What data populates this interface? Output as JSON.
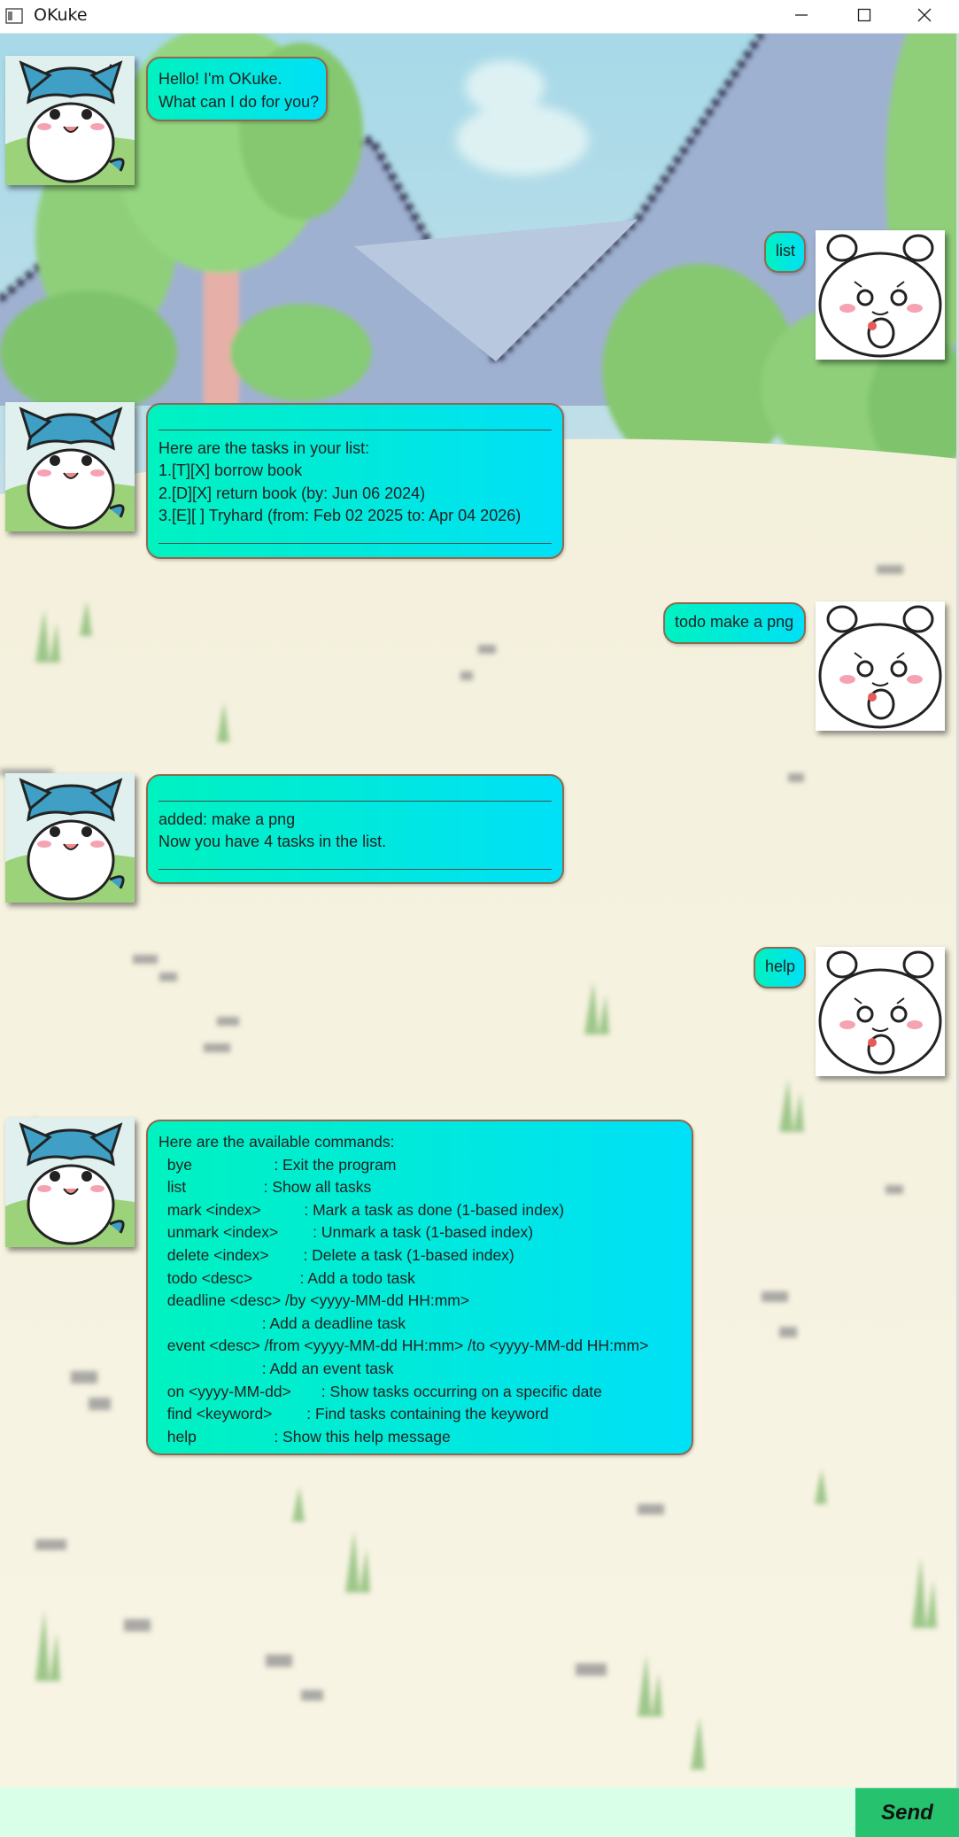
{
  "window": {
    "title": "OKuke",
    "controls": [
      "minimize-icon",
      "maximize-icon",
      "close-icon"
    ]
  },
  "chat": {
    "bot_name": "OKuke",
    "colors": {
      "bubble_start": "#00f2c0",
      "bubble_end": "#00e0f7",
      "bubble_border": "#8d6a4f",
      "input_bg": "#d9ffe8",
      "send_bg": "#26c26e"
    },
    "messages": [
      {
        "sender": "bot",
        "lines": [
          "Hello! I'm OKuke.",
          "What can I do for you?"
        ]
      },
      {
        "sender": "user",
        "lines": [
          "list"
        ]
      },
      {
        "sender": "bot",
        "lines": [
          "____",
          "Here are the tasks in your list:",
          "1.[T][X] borrow book",
          "2.[D][X] return book (by: Jun 06 2024)",
          "3.[E][ ] Tryhard (from: Feb 02 2025 to: Apr 04 2026)",
          "____"
        ]
      },
      {
        "sender": "user",
        "lines": [
          "todo make a png"
        ]
      },
      {
        "sender": "bot",
        "lines": [
          "____",
          "added: make a png",
          "Now you have 4 tasks in the list.",
          "____"
        ]
      },
      {
        "sender": "user",
        "lines": [
          "help"
        ]
      },
      {
        "sender": "bot",
        "lines": [
          "Here are the available commands:",
          "  bye                   : Exit the program",
          "  list                  : Show all tasks",
          "  mark <index>          : Mark a task as done (1-based index)",
          "  unmark <index>        : Unmark a task (1-based index)",
          "  delete <index>        : Delete a task (1-based index)",
          "  todo <desc>           : Add a todo task",
          "  deadline <desc> /by <yyyy-MM-dd HH:mm>",
          "                        : Add a deadline task",
          "  event <desc> /from <yyyy-MM-dd HH:mm> /to <yyyy-MM-dd HH:mm>",
          "                        : Add an event task",
          "  on <yyyy-MM-dd>       : Show tasks occurring on a specific date",
          "  find <keyword>        : Find tasks containing the keyword",
          "  help                  : Show this help message"
        ]
      }
    ]
  },
  "input": {
    "value": "",
    "placeholder": ""
  },
  "send_button": {
    "label": "Send"
  }
}
